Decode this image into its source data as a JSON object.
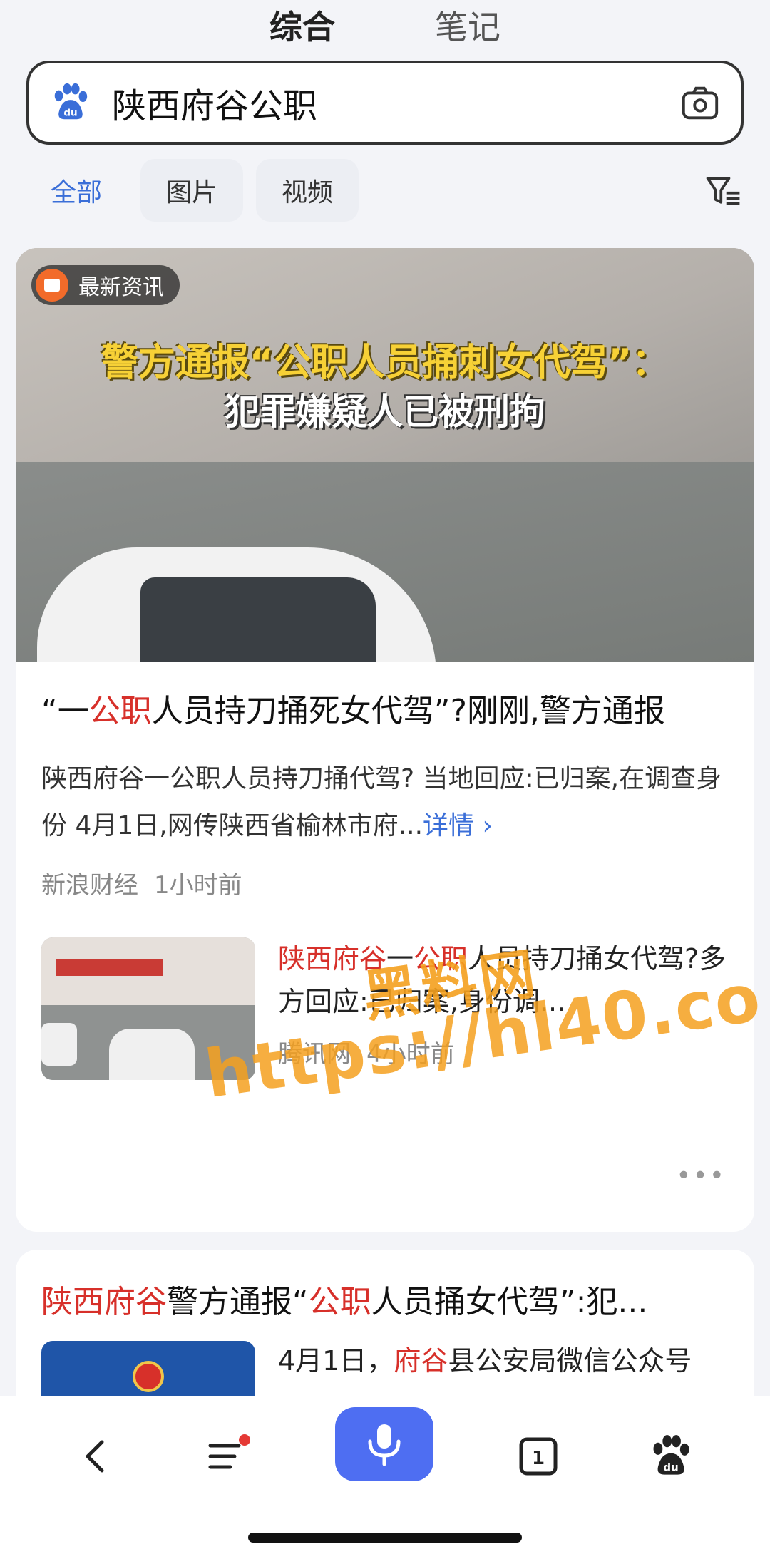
{
  "top_tabs": [
    {
      "label": "综合"
    },
    {
      "label": "笔记"
    }
  ],
  "search": {
    "query": "陕西府谷公职"
  },
  "filters": [
    {
      "label": "全部"
    },
    {
      "label": "图片"
    },
    {
      "label": "视频"
    }
  ],
  "result1": {
    "badge": "最新资讯",
    "hero_line1": "警方通报“公职人员捅刺女代驾”：",
    "hero_line2": "犯罪嫌疑人已被刑拘",
    "title_pre": "“一",
    "title_hl": "公职",
    "title_post": "人员持刀捅死女代驾”?刚刚,警方通报",
    "desc": "陕西府谷一公职人员持刀捅代驾? 当地回应:已归案,在调查身份 4月1日,网传陕西省榆林市府...",
    "desc_more": "详情 ›",
    "source": "新浪财经",
    "time": "1小时前",
    "sub": {
      "title_hl1": "陕西府谷",
      "title_mid": "一",
      "title_hl2": "公职",
      "title_post": "人员持刀捅女代驾?多方回应:已归案,身份调...",
      "source": "腾讯网",
      "time": "4小时前"
    },
    "more": "•••"
  },
  "result2": {
    "title_hl1": "陕西府谷",
    "title_mid": "警方通报“",
    "title_hl2": "公职",
    "title_post": "人员捅女代驾”:犯...",
    "text_pre": "4月1日，",
    "text_hl": "府谷",
    "text_post": "县公安局微信公众号"
  },
  "watermark": {
    "line1": "黑料网",
    "line2": "https://hl40.co"
  },
  "bottom_bar": {
    "tabs_count": "1"
  },
  "colors": {
    "accent": "#3a6ed8",
    "highlight": "#d7302a",
    "mic": "#4e6ef2",
    "watermark": "#f4a01e"
  }
}
